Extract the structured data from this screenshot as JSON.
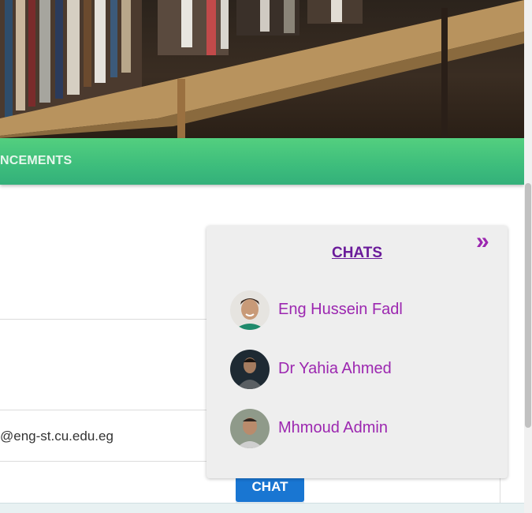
{
  "nav": {
    "item_label": "NCEMENTS"
  },
  "content": {
    "email": "@eng-st.cu.edu.eg",
    "chat_button": "CHAT"
  },
  "chats": {
    "title": "CHATS",
    "collapse_glyph": "»",
    "items": [
      {
        "name": "Eng Hussein Fadl"
      },
      {
        "name": "Dr Yahia Ahmed"
      },
      {
        "name": "Mhmoud Admin"
      }
    ]
  },
  "colors": {
    "nav_green": "#3dbd7c",
    "accent_purple": "#9c27b0",
    "button_blue": "#1976d2"
  }
}
